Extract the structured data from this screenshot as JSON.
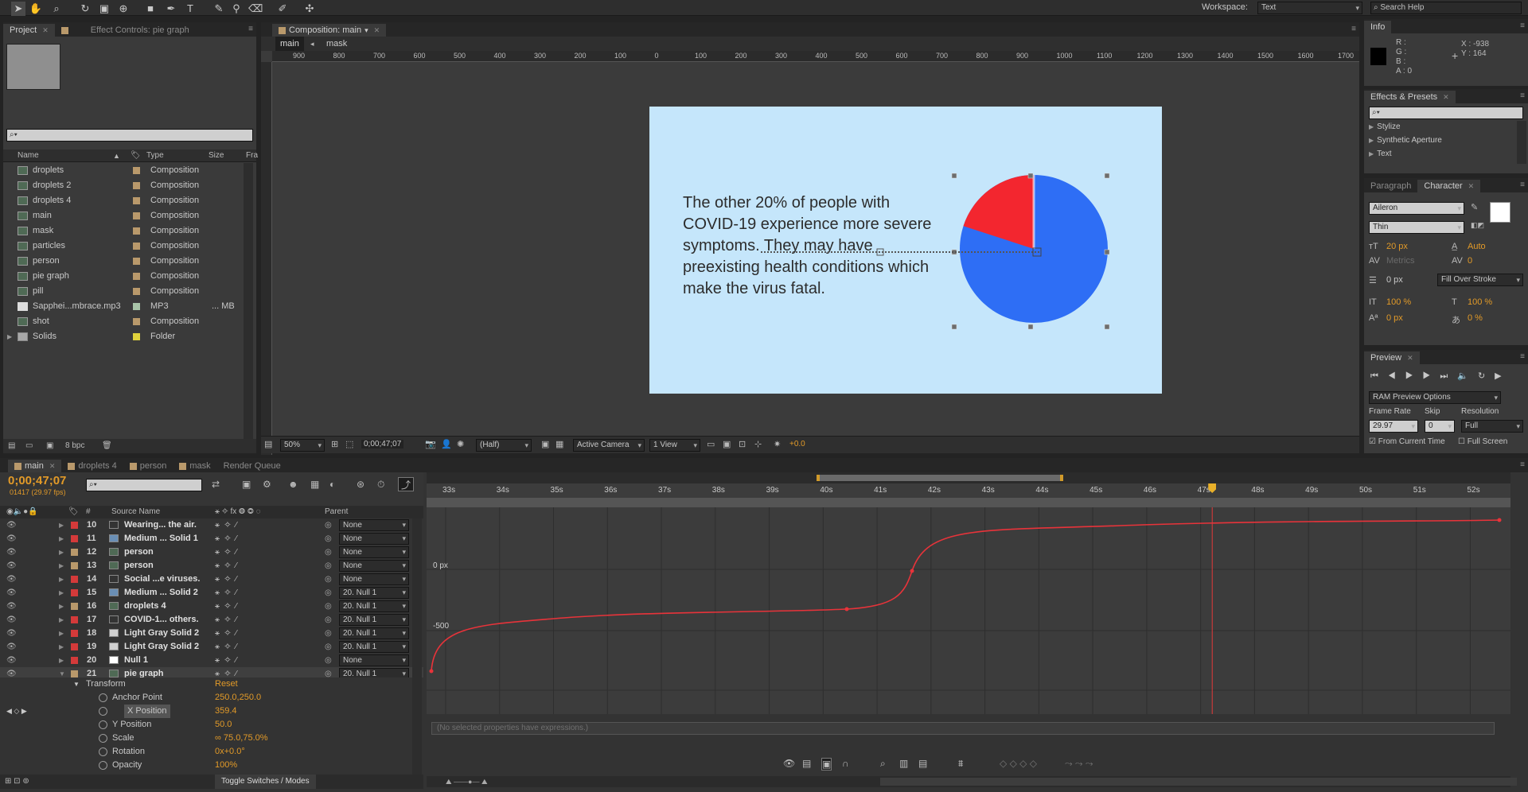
{
  "toolbar": {
    "workspace_label": "Workspace:",
    "workspace_value": "Text",
    "search_placeholder": "Search Help"
  },
  "project_panel": {
    "tabs": [
      {
        "label": "Project"
      },
      {
        "label": "Effect Controls: pie graph"
      }
    ],
    "search_placeholder": "",
    "columns": {
      "name": "Name",
      "type": "Type",
      "size": "Size",
      "fr": "Fra"
    },
    "items": [
      {
        "name": "droplets",
        "type": "Composition",
        "size": ""
      },
      {
        "name": "droplets 2",
        "type": "Composition",
        "size": ""
      },
      {
        "name": "droplets 4",
        "type": "Composition",
        "size": ""
      },
      {
        "name": "main",
        "type": "Composition",
        "size": ""
      },
      {
        "name": "mask",
        "type": "Composition",
        "size": ""
      },
      {
        "name": "particles",
        "type": "Composition",
        "size": ""
      },
      {
        "name": "person",
        "type": "Composition",
        "size": ""
      },
      {
        "name": "pie graph",
        "type": "Composition",
        "size": ""
      },
      {
        "name": "pill",
        "type": "Composition",
        "size": ""
      },
      {
        "name": "Sapphei...mbrace.mp3",
        "type": "MP3",
        "size": "... MB"
      },
      {
        "name": "shot",
        "type": "Composition",
        "size": ""
      },
      {
        "name": "Solids",
        "type": "Folder",
        "size": ""
      }
    ],
    "bpc": "8 bpc"
  },
  "composition_panel": {
    "tab": "Composition: main",
    "breadcrumb": [
      "main",
      "mask"
    ],
    "ruler_labels": [
      "900",
      "800",
      "700",
      "600",
      "500",
      "400",
      "300",
      "200",
      "100",
      "0",
      "100",
      "200",
      "300",
      "400",
      "500",
      "600",
      "700",
      "800",
      "900",
      "1000",
      "1100",
      "1200",
      "1300",
      "1400",
      "1500",
      "1600",
      "1700"
    ],
    "canvas_text": "The other 20% of people with COVID-19 experience more severe symptoms. They may have preexisting health conditions which make the virus fatal.",
    "pie": {
      "blue_pct": 80,
      "red_pct": 20,
      "blue": "#2e6ef5",
      "red": "#f3262f",
      "background": "#c5e6fb"
    },
    "footer": {
      "zoom": "50%",
      "timecode": "0;00;47;07",
      "resolution": "(Half)",
      "camera": "Active Camera",
      "views": "1 View",
      "exposure": "+0.0"
    }
  },
  "info_panel": {
    "tab": "Info",
    "r": "R :",
    "g": "G :",
    "b": "B :",
    "a": "A : 0",
    "x": "X : -938",
    "y": "Y : 164"
  },
  "effects_panel": {
    "tab": "Effects & Presets",
    "items": [
      "Stylize",
      "Synthetic Aperture",
      "Text"
    ]
  },
  "character_panel": {
    "tabs": [
      "Paragraph",
      "Character"
    ],
    "font": "Aileron",
    "style": "Thin",
    "size": "20 px",
    "leading": "Auto",
    "kerning": "Metrics",
    "tracking": "0",
    "stroke_width": "0 px",
    "stroke_type": "Fill Over Stroke",
    "vscale": "100 %",
    "hscale": "100 %",
    "baseline": "0 px",
    "tsume": "0 %"
  },
  "preview_panel": {
    "tab": "Preview",
    "ram_options": "RAM Preview Options",
    "frame_rate_label": "Frame Rate",
    "skip_label": "Skip",
    "resolution_label": "Resolution",
    "frame_rate": "29.97",
    "skip": "0",
    "resolution": "Full",
    "from_current": "From Current Time",
    "full_screen": "Full Screen"
  },
  "timeline": {
    "tabs": [
      {
        "label": "main",
        "color": "#b9996b"
      },
      {
        "label": "droplets 4",
        "color": "#b9996b"
      },
      {
        "label": "person",
        "color": "#b9996b"
      },
      {
        "label": "mask",
        "color": "#b9996b"
      },
      {
        "label": "Render Queue",
        "color": ""
      }
    ],
    "timecode": "0;00;47;07",
    "frame_info": "01417 (29.97 fps)",
    "col_source": "Source Name",
    "col_parent": "Parent",
    "time_labels": [
      "33s",
      "34s",
      "35s",
      "36s",
      "37s",
      "38s",
      "39s",
      "40s",
      "41s",
      "42s",
      "43s",
      "44s",
      "45s",
      "46s",
      "47s",
      "48s",
      "49s",
      "50s",
      "51s",
      "52s"
    ],
    "graph_labels": [
      "0 px",
      "-500"
    ],
    "layers": [
      {
        "num": "10",
        "name": "Wearing... the air.",
        "label": "#d43a3a",
        "parent": "None",
        "icon": "text"
      },
      {
        "num": "11",
        "name": "Medium ... Solid 1",
        "label": "#d43a3a",
        "parent": "None",
        "icon": "solid-blue"
      },
      {
        "num": "12",
        "name": "person",
        "label": "#b9996b",
        "parent": "None",
        "icon": "comp"
      },
      {
        "num": "13",
        "name": "person",
        "label": "#b9996b",
        "parent": "None",
        "icon": "comp"
      },
      {
        "num": "14",
        "name": "Social ...e viruses.",
        "label": "#d43a3a",
        "parent": "None",
        "icon": "text"
      },
      {
        "num": "15",
        "name": "Medium ... Solid 2",
        "label": "#d43a3a",
        "parent": "20. Null 1",
        "icon": "solid-blue"
      },
      {
        "num": "16",
        "name": "droplets 4",
        "label": "#b9996b",
        "parent": "20. Null 1",
        "icon": "comp"
      },
      {
        "num": "17",
        "name": "COVID-1... others.",
        "label": "#d43a3a",
        "parent": "20. Null 1",
        "icon": "text"
      },
      {
        "num": "18",
        "name": "Light Gray Solid 2",
        "label": "#d43a3a",
        "parent": "20. Null 1",
        "icon": "solid-gray"
      },
      {
        "num": "19",
        "name": "Light Gray Solid 2",
        "label": "#d43a3a",
        "parent": "20. Null 1",
        "icon": "solid-gray"
      },
      {
        "num": "20",
        "name": "Null 1",
        "label": "#d43a3a",
        "parent": "None",
        "icon": "null"
      },
      {
        "num": "21",
        "name": "pie graph",
        "label": "#b9996b",
        "parent": "20. Null 1",
        "icon": "comp"
      }
    ],
    "transform_label": "Transform",
    "reset_label": "Reset",
    "properties": [
      {
        "name": "Anchor Point",
        "value": "250.0,250.0"
      },
      {
        "name": "X Position",
        "value": "359.4"
      },
      {
        "name": "Y Position",
        "value": "50.0"
      },
      {
        "name": "Scale",
        "value": "∞ 75.0,75.0%"
      },
      {
        "name": "Rotation",
        "value": "0x+0.0°"
      },
      {
        "name": "Opacity",
        "value": "100%"
      }
    ],
    "toggle_label": "Toggle Switches / Modes",
    "expression_placeholder": "(No selected properties have expressions.)",
    "curve_color": "#e8333a"
  }
}
